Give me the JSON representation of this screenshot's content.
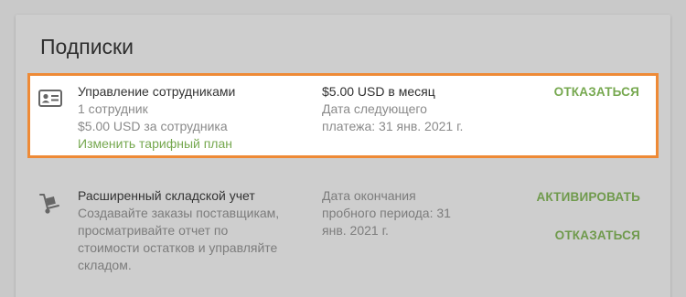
{
  "page": {
    "title": "Подписки"
  },
  "subscriptions": [
    {
      "icon": "id-card-icon",
      "name": "Управление сотрудниками",
      "details": [
        "1 сотрудник",
        "$5.00 USD за сотрудника"
      ],
      "change_plan_link": "Изменить тарифный план",
      "price": "$5.00 USD в месяц",
      "next_payment_lines": [
        "Дата следующего",
        "платежа: 31 янв. 2021 г."
      ],
      "actions": [
        "ОТКАЗАТЬСЯ"
      ]
    },
    {
      "icon": "hand-truck-icon",
      "name": "Расширенный складской учет",
      "description_lines": [
        "Создавайте заказы поставщикам,",
        "просматривайте отчет по",
        "стоимости остатков и управляйте",
        "складом."
      ],
      "trial_end_lines": [
        "Дата окончания",
        "пробного периода: 31",
        "янв. 2021 г."
      ],
      "actions": [
        "АКТИВИРОВАТЬ",
        "ОТКАЗАТЬСЯ"
      ]
    }
  ],
  "colors": {
    "accent_green": "#76a84f",
    "highlight_border": "#ee8a36"
  }
}
